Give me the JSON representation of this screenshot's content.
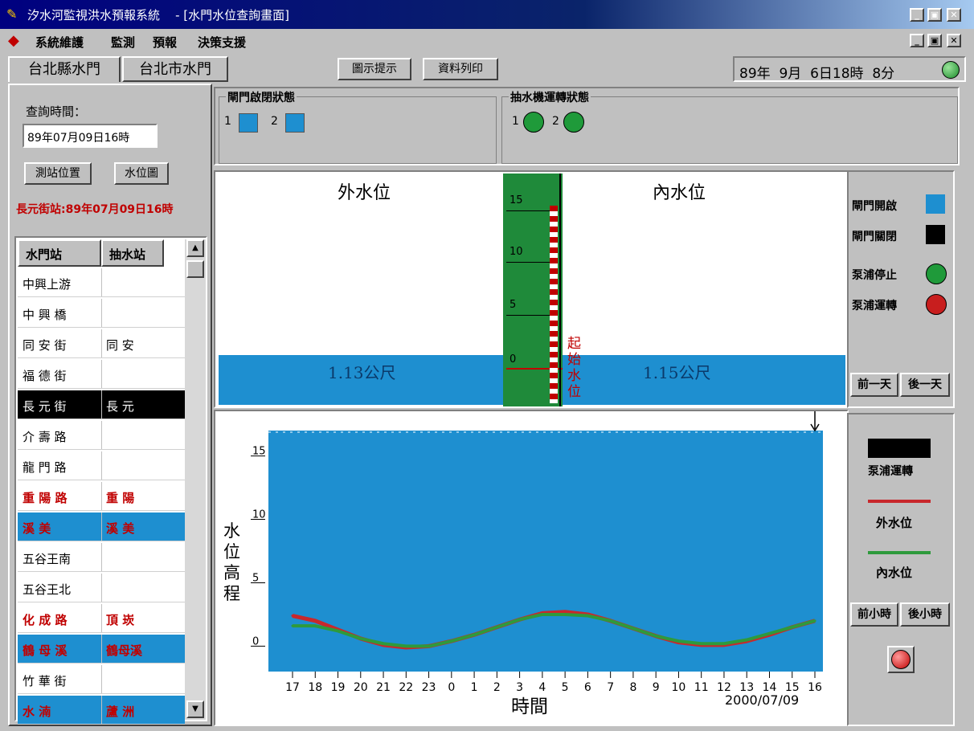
{
  "window": {
    "title": "汐水河監視洪水預報系統    - [水門水位查詢畫面]",
    "controls": [
      "_",
      "▣",
      "✕"
    ]
  },
  "menu": {
    "items": [
      "系統維護",
      "監測",
      "預報",
      "決策支援"
    ]
  },
  "tabs": [
    "台北縣水門",
    "台北市水門"
  ],
  "toolbar": {
    "hint_button": "圖示提示",
    "print_button": "資料列印"
  },
  "clock": {
    "text": "89年  9月  6日18時  8分"
  },
  "query": {
    "label": "查詢時間：",
    "value": "89年07月09日16時",
    "station_button": "測站位置",
    "level_button": "水位圖",
    "status_line": "長元街站:89年07月09日16時"
  },
  "gate_status": {
    "title": "閘門啟閉狀態",
    "items": [
      "1",
      "2"
    ]
  },
  "pump_status": {
    "title": "抽水機運轉狀態",
    "items": [
      "1",
      "2"
    ]
  },
  "station_list": {
    "headers": [
      "水門站",
      "抽水站"
    ],
    "rows": [
      {
        "gate": "中興上游",
        "pump": ""
      },
      {
        "gate": "中 興 橋",
        "pump": ""
      },
      {
        "gate": "同 安 街",
        "pump": "同   安"
      },
      {
        "gate": "福 德 街",
        "pump": ""
      },
      {
        "gate": "長 元 街",
        "pump": "長   元"
      },
      {
        "gate": "介 壽 路",
        "pump": ""
      },
      {
        "gate": "龍 門 路",
        "pump": ""
      },
      {
        "gate": "重 陽 路",
        "pump": "重   陽"
      },
      {
        "gate": "溪       美",
        "pump": "溪   美"
      },
      {
        "gate": "五谷王南",
        "pump": ""
      },
      {
        "gate": "五谷王北",
        "pump": ""
      },
      {
        "gate": "化 成 路",
        "pump": "頂   崁"
      },
      {
        "gate": "鶴 母 溪",
        "pump": "鶴母溪"
      },
      {
        "gate": "竹 華 街",
        "pump": ""
      },
      {
        "gate": "水       湳",
        "pump": "蘆   洲"
      }
    ]
  },
  "gauge": {
    "outer_label": "外水位",
    "inner_label": "內水位",
    "outer_value": "1.13公尺",
    "inner_value": "1.15公尺",
    "start_label": "起始水位",
    "scale_ticks": [
      "15",
      "10",
      "5",
      "0"
    ]
  },
  "legend_top": {
    "gate_open": "閘門開啟",
    "gate_closed": "閘門關閉",
    "pump_stop": "泵浦停止",
    "pump_run": "泵浦運轉",
    "prev_day": "前一天",
    "next_day": "後一天"
  },
  "legend_bottom": {
    "pump_run": "泵浦運轉",
    "outer": "外水位",
    "inner": "內水位",
    "prev_hour": "前小時",
    "next_hour": "後小時"
  },
  "colors": {
    "water": "#1e8fd0",
    "gauge_green": "#1f8a3a",
    "outer_line": "#c8282c",
    "inner_line": "#2e9a3c",
    "gate_blue": "#1e8fd0",
    "alert_red": "#c00000"
  },
  "chart_data": {
    "type": "line",
    "ylabel": "水位高程",
    "xlabel": "時間",
    "date": "2000/07/09",
    "ylim": [
      -2,
      17
    ],
    "y_ticks": [
      "15",
      "10",
      "5",
      "0"
    ],
    "categories": [
      "17",
      "18",
      "19",
      "20",
      "21",
      "22",
      "23",
      "0",
      "1",
      "2",
      "3",
      "4",
      "5",
      "6",
      "7",
      "8",
      "9",
      "10",
      "11",
      "12",
      "13",
      "14",
      "15",
      "16"
    ],
    "series": [
      {
        "name": "外水位",
        "values": [
          2.4,
          2.0,
          1.3,
          0.6,
          0.1,
          -0.1,
          0.0,
          0.4,
          0.9,
          1.5,
          2.1,
          2.6,
          2.7,
          2.5,
          2.0,
          1.4,
          0.8,
          0.3,
          0.1,
          0.1,
          0.4,
          0.9,
          1.5,
          2.0
        ]
      },
      {
        "name": "內水位",
        "values": [
          1.6,
          1.6,
          1.2,
          0.6,
          0.2,
          0.0,
          0.0,
          0.4,
          0.9,
          1.5,
          2.1,
          2.5,
          2.5,
          2.4,
          2.0,
          1.4,
          0.8,
          0.4,
          0.2,
          0.2,
          0.5,
          1.0,
          1.5,
          2.0
        ]
      }
    ],
    "grid": false
  }
}
